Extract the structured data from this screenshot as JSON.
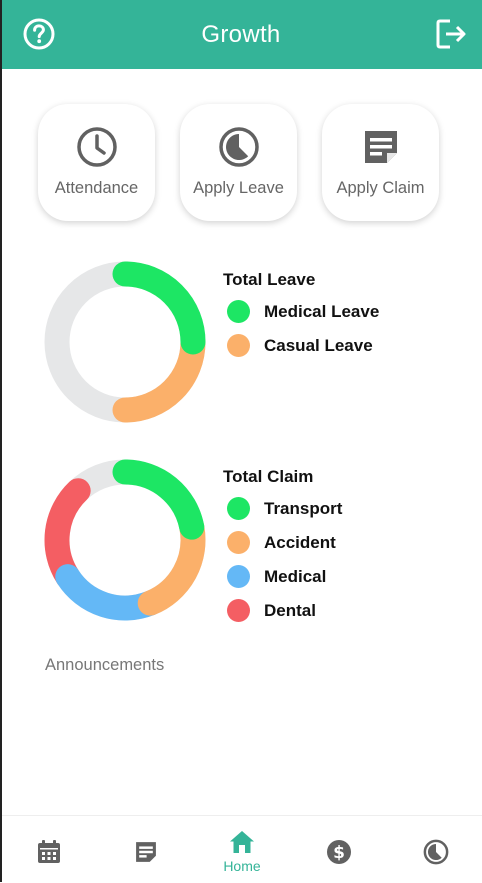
{
  "header": {
    "title": "Growth",
    "help_icon": "help-circle-icon",
    "logout_icon": "logout-icon",
    "bg_color": "#34b498"
  },
  "quick_actions": [
    {
      "label": "Attendance",
      "icon": "clock-icon"
    },
    {
      "label": "Apply Leave",
      "icon": "pie-timer-icon"
    },
    {
      "label": "Apply Claim",
      "icon": "note-icon"
    }
  ],
  "chart_data": [
    {
      "type": "pie",
      "title": "Total Leave",
      "series": [
        {
          "name": "Medical Leave",
          "value": 1,
          "color": "#1de664"
        },
        {
          "name": "Casual Leave",
          "value": 1,
          "color": "#fbb06a"
        }
      ],
      "remainder_color": "#e6e7e8",
      "remainder_value": 2
    },
    {
      "type": "pie",
      "title": "Total Claim",
      "series": [
        {
          "name": "Transport",
          "value": 1,
          "color": "#1de664"
        },
        {
          "name": "Accident",
          "value": 1,
          "color": "#fbb06a"
        },
        {
          "name": "Medical",
          "value": 1,
          "color": "#64b8f6"
        },
        {
          "name": "Dental",
          "value": 1,
          "color": "#f45e63"
        }
      ],
      "remainder_color": "#e6e7e8",
      "remainder_value": 0.55
    }
  ],
  "announcements": {
    "label": "Announcements"
  },
  "bottom_nav": [
    {
      "name": "calendar",
      "icon": "calendar-icon",
      "label": ""
    },
    {
      "name": "claims",
      "icon": "note-icon",
      "label": ""
    },
    {
      "name": "home",
      "icon": "home-icon",
      "label": "Home",
      "active": true
    },
    {
      "name": "payroll",
      "icon": "dollar-icon",
      "label": ""
    },
    {
      "name": "leave",
      "icon": "pie-timer-icon",
      "label": ""
    }
  ]
}
